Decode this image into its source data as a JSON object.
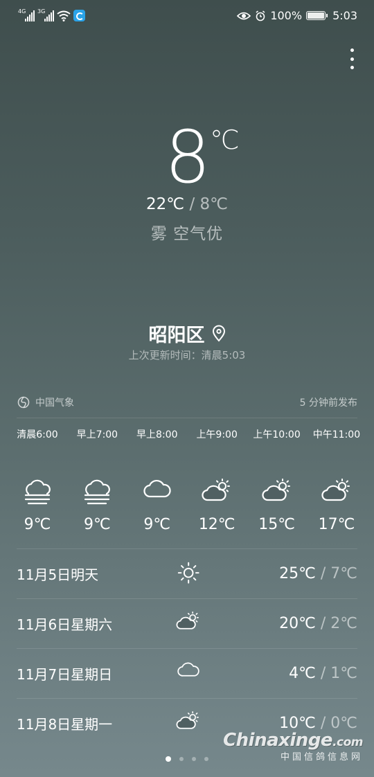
{
  "status_bar": {
    "signal1_tag": "4G",
    "signal2_tag": "3G",
    "battery_percent": "100%",
    "time": "5:03"
  },
  "current": {
    "temperature": "8",
    "unit": "℃",
    "high": "22℃",
    "separator": "/",
    "low": "8℃",
    "condition": "雾 空气优"
  },
  "location": {
    "name": "昭阳区",
    "updated": "上次更新时间：清晨5:03"
  },
  "source": {
    "name": "中国气象",
    "published": "5 分钟前发布"
  },
  "hourly": [
    {
      "time": "清晨6:00",
      "icon": "fog-icon",
      "temp": "9℃"
    },
    {
      "time": "早上7:00",
      "icon": "fog-icon",
      "temp": "9℃"
    },
    {
      "time": "早上8:00",
      "icon": "cloudy-icon",
      "temp": "9℃"
    },
    {
      "time": "上午9:00",
      "icon": "partly-cloudy-icon",
      "temp": "12℃"
    },
    {
      "time": "上午10:00",
      "icon": "partly-cloudy-icon",
      "temp": "15℃"
    },
    {
      "time": "中午11:00",
      "icon": "partly-cloudy-icon",
      "temp": "17℃"
    }
  ],
  "daily": [
    {
      "date": "11月5日明天",
      "icon": "sunny-icon",
      "high": "25℃",
      "low": "7℃"
    },
    {
      "date": "11月6日星期六",
      "icon": "partly-cloudy-icon",
      "high": "20℃",
      "low": "2℃"
    },
    {
      "date": "11月7日星期日",
      "icon": "cloudy-icon",
      "high": "4℃",
      "low": "1℃"
    },
    {
      "date": "11月8日星期一",
      "icon": "partly-cloudy-icon",
      "high": "10℃",
      "low": "0℃"
    }
  ],
  "pager": {
    "count": 4,
    "active": 0
  },
  "watermark": {
    "brand": "Chinaxinge",
    "brand_suffix": ".com",
    "chinese": "中国信鸽信息网"
  }
}
